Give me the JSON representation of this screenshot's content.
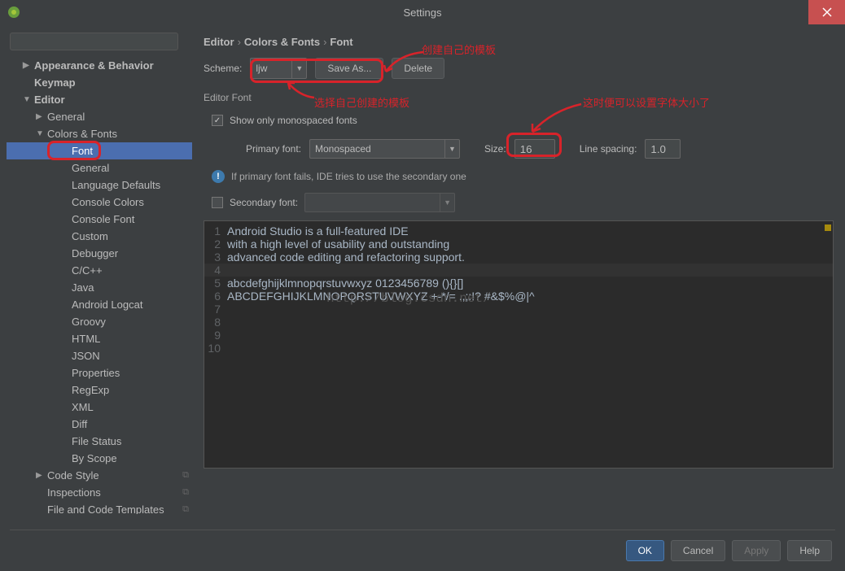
{
  "window": {
    "title": "Settings"
  },
  "search": {
    "placeholder": ""
  },
  "sidebar": {
    "items": [
      {
        "label": "Appearance & Behavior",
        "arrow": "▶",
        "bold": true,
        "lvl": "l1"
      },
      {
        "label": "Keymap",
        "bold": true,
        "lvl": "l1",
        "indent": true
      },
      {
        "label": "Editor",
        "arrow": "▼",
        "bold": true,
        "lvl": "l1"
      },
      {
        "label": "General",
        "arrow": "▶",
        "lvl": "l2"
      },
      {
        "label": "Colors & Fonts",
        "arrow": "▼",
        "lvl": "l2"
      },
      {
        "label": "Font",
        "lvl": "l4",
        "selected": true
      },
      {
        "label": "General",
        "lvl": "l4"
      },
      {
        "label": "Language Defaults",
        "lvl": "l4"
      },
      {
        "label": "Console Colors",
        "lvl": "l4"
      },
      {
        "label": "Console Font",
        "lvl": "l4"
      },
      {
        "label": "Custom",
        "lvl": "l4"
      },
      {
        "label": "Debugger",
        "lvl": "l4"
      },
      {
        "label": "C/C++",
        "lvl": "l4"
      },
      {
        "label": "Java",
        "lvl": "l4"
      },
      {
        "label": "Android Logcat",
        "lvl": "l4"
      },
      {
        "label": "Groovy",
        "lvl": "l4"
      },
      {
        "label": "HTML",
        "lvl": "l4"
      },
      {
        "label": "JSON",
        "lvl": "l4"
      },
      {
        "label": "Properties",
        "lvl": "l4"
      },
      {
        "label": "RegExp",
        "lvl": "l4"
      },
      {
        "label": "XML",
        "lvl": "l4"
      },
      {
        "label": "Diff",
        "lvl": "l4"
      },
      {
        "label": "File Status",
        "lvl": "l4"
      },
      {
        "label": "By Scope",
        "lvl": "l4"
      },
      {
        "label": "Code Style",
        "arrow": "▶",
        "lvl": "l2",
        "copy": true
      },
      {
        "label": "Inspections",
        "lvl": "l2",
        "indent": true,
        "copy": true
      },
      {
        "label": "File and Code Templates",
        "lvl": "l2",
        "indent": true,
        "copy": true
      }
    ]
  },
  "breadcrumb": {
    "part1": "Editor",
    "part2": "Colors & Fonts",
    "part3": "Font"
  },
  "scheme": {
    "label": "Scheme:",
    "value": "ljw",
    "save_as": "Save As...",
    "delete": "Delete"
  },
  "editor_font": {
    "title": "Editor Font",
    "show_mono": "Show only monospaced fonts",
    "primary_label": "Primary font:",
    "primary_value": "Monospaced",
    "size_label": "Size:",
    "size_value": "16",
    "spacing_label": "Line spacing:",
    "spacing_value": "1.0",
    "info": "If primary font fails, IDE tries to use the secondary one",
    "secondary_label": "Secondary font:",
    "secondary_value": ""
  },
  "preview": {
    "lines": [
      "Android Studio is a full-featured IDE",
      "with a high level of usability and outstanding",
      "advanced code editing and refactoring support.",
      "",
      "abcdefghijklmnopqrstuvwxyz 0123456789 (){}[]",
      "ABCDEFGHIJKLMNOPQRSTUVWXYZ +-*/= .,;:!? #&$%@|^",
      "",
      "",
      "",
      ""
    ],
    "watermark": "http://blog.csdn.net/"
  },
  "footer": {
    "ok": "OK",
    "cancel": "Cancel",
    "apply": "Apply",
    "help": "Help"
  },
  "annotations": {
    "a1": "创建自己的模板",
    "a2": "选择自己创建的模板",
    "a3": "这时便可以设置字体大小了"
  }
}
